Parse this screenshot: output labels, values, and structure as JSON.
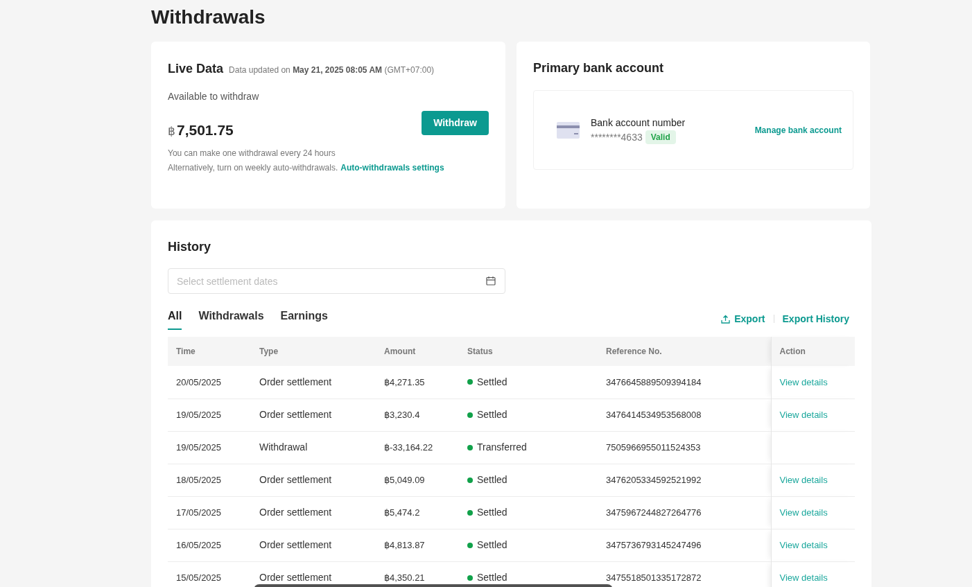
{
  "page_title": "Withdrawals",
  "live_data": {
    "title": "Live Data",
    "updated_prefix": "Data updated on",
    "updated_time": "May 21, 2025 08:05 AM",
    "timezone": "(GMT+07:00)",
    "available_label": "Available to withdraw",
    "currency": "฿",
    "amount": "7,501.75",
    "withdraw_button": "Withdraw",
    "note_1": "You can make one withdrawal every 24 hours",
    "note_2": "Alternatively, turn on weekly auto-withdrawals.",
    "settings_link": "Auto-withdrawals settings"
  },
  "bank_account": {
    "title": "Primary bank account",
    "label": "Bank account number",
    "number": "********4633",
    "badge": "Valid",
    "manage_link": "Manage bank account"
  },
  "history": {
    "title": "History",
    "date_placeholder": "Select settlement dates",
    "tabs": [
      {
        "label": "All",
        "selected": true
      },
      {
        "label": "Withdrawals",
        "selected": false
      },
      {
        "label": "Earnings",
        "selected": false
      }
    ],
    "export": "Export",
    "export_history": "Export History",
    "columns": [
      "Time",
      "Type",
      "Amount",
      "Status",
      "Reference No.",
      "Action"
    ],
    "rows": [
      {
        "time": "20/05/2025",
        "type": "Order settlement",
        "amount": "฿4,271.35",
        "status": "Settled",
        "reference": "3476645889509394184",
        "action": "View details"
      },
      {
        "time": "19/05/2025",
        "type": "Order settlement",
        "amount": "฿3,230.4",
        "status": "Settled",
        "reference": "3476414534953568008",
        "action": "View details"
      },
      {
        "time": "19/05/2025",
        "type": "Withdrawal",
        "amount": "฿-33,164.22",
        "status": "Transferred",
        "reference": "7505966955011524353"
      },
      {
        "time": "18/05/2025",
        "type": "Order settlement",
        "amount": "฿5,049.09",
        "status": "Settled",
        "reference": "3476205334592521992",
        "action": "View details"
      },
      {
        "time": "17/05/2025",
        "type": "Order settlement",
        "amount": "฿5,474.2",
        "status": "Settled",
        "reference": "3475967244827264776",
        "action": "View details"
      },
      {
        "time": "16/05/2025",
        "type": "Order settlement",
        "amount": "฿4,813.87",
        "status": "Settled",
        "reference": "3475736793145247496",
        "action": "View details"
      },
      {
        "time": "15/05/2025",
        "type": "Order settlement",
        "amount": "฿4,350.21",
        "status": "Settled",
        "reference": "3475518501335172872",
        "action": "View details"
      }
    ]
  }
}
